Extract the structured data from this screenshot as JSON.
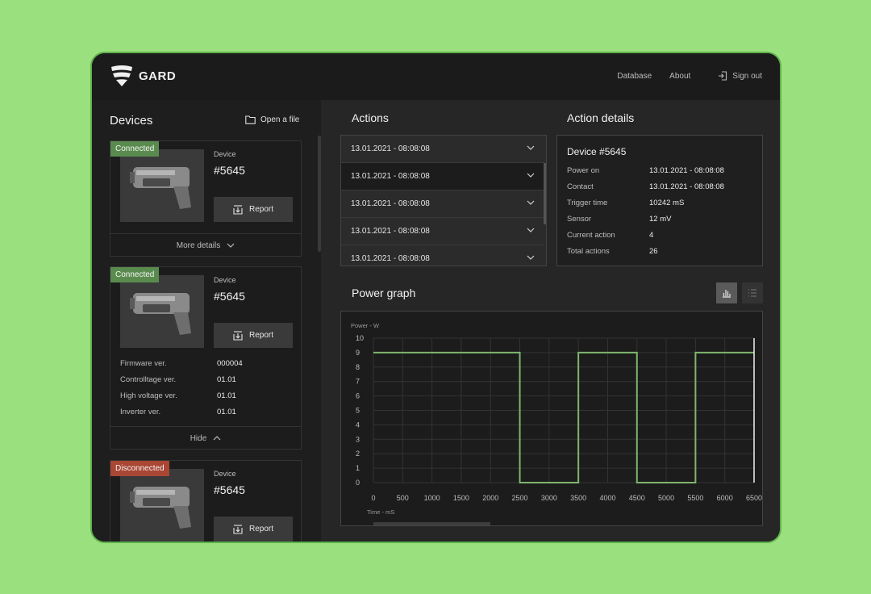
{
  "app": {
    "brand": "GARD",
    "nav": [
      "Database",
      "About"
    ],
    "signout": "Sign out"
  },
  "devices": {
    "title": "Devices",
    "open_file": "Open a file",
    "cards": [
      {
        "status": "Connected",
        "label": "Device",
        "id": "#5645",
        "report": "Report",
        "toggle": "More details"
      },
      {
        "status": "Connected",
        "label": "Device",
        "id": "#5645",
        "report": "Report",
        "specs": [
          {
            "key": "Firmware ver.",
            "value": "000004"
          },
          {
            "key": "Controlltage ver.",
            "value": "01.01"
          },
          {
            "key": "High voltage ver.",
            "value": "01.01"
          },
          {
            "key": "Inverter ver.",
            "value": "01.01"
          }
        ],
        "toggle": "Hide"
      },
      {
        "status": "Disconnected",
        "label": "Device",
        "id": "#5645",
        "report": "Report"
      }
    ]
  },
  "actions": {
    "title": "Actions",
    "rows": [
      "13.01.2021 - 08:08:08",
      "13.01.2021 - 08:08:08",
      "13.01.2021 - 08:08:08",
      "13.01.2021 - 08:08:08",
      "13.01.2021 - 08:08:08"
    ],
    "selected_index": 1
  },
  "details": {
    "title": "Action details",
    "device": "Device #5645",
    "rows": [
      {
        "key": "Power on",
        "value": "13.01.2021 - 08:08:08"
      },
      {
        "key": "Contact",
        "value": "13.01.2021 - 08:08:08"
      },
      {
        "key": "Trigger time",
        "value": "10242 mS"
      },
      {
        "key": "Sensor",
        "value": "12 mV"
      },
      {
        "key": "Current action",
        "value": "4"
      },
      {
        "key": "Total actions",
        "value": "26"
      }
    ]
  },
  "graph": {
    "title": "Power graph"
  },
  "chart_data": {
    "type": "line",
    "ylabel": "Power - W",
    "xlabel": "Time - mS",
    "xlim": [
      0,
      6500
    ],
    "ylim": [
      0,
      10
    ],
    "x_ticks": [
      0,
      500,
      1000,
      1500,
      2000,
      2500,
      3000,
      3500,
      4000,
      4500,
      5000,
      5500,
      6000,
      6500
    ],
    "y_ticks": [
      0,
      1,
      2,
      3,
      4,
      5,
      6,
      7,
      8,
      9,
      10
    ],
    "grid": true,
    "series": [
      {
        "x": [
          0,
          2500,
          2500,
          3500,
          3500,
          4500,
          4500,
          5500,
          5500,
          6500
        ],
        "y": [
          9,
          9,
          0,
          0,
          9,
          9,
          0,
          0,
          9,
          9
        ]
      }
    ],
    "line_color": "#7fb56e",
    "cursor_x": 6500
  }
}
